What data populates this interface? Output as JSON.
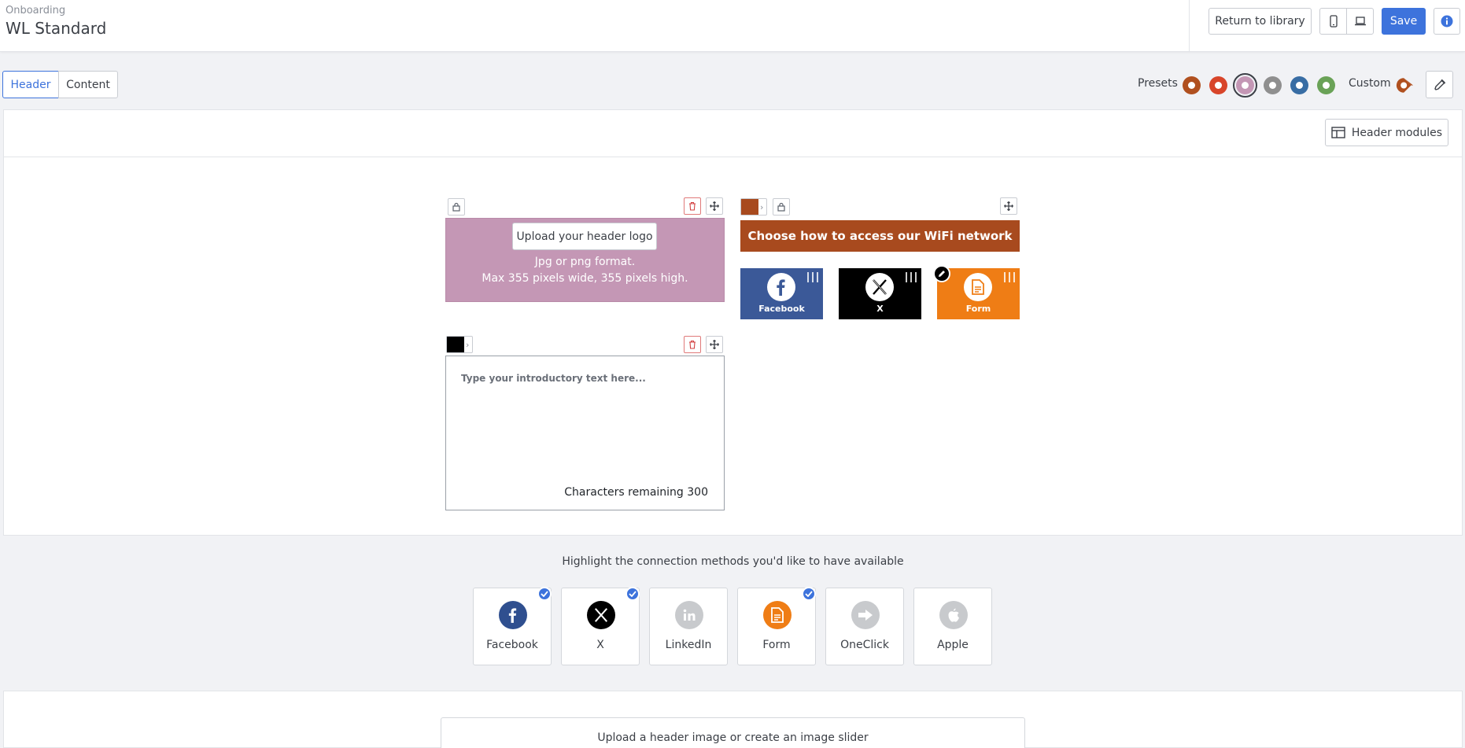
{
  "header": {
    "breadcrumb": "Onboarding",
    "title": "WL Standard",
    "return_label": "Return to library",
    "save_label": "Save",
    "mobile_icon": "mobile-icon",
    "desktop_icon": "laptop-icon",
    "info_icon": "info-icon"
  },
  "tabs": [
    {
      "label": "Header",
      "active": true
    },
    {
      "label": "Content",
      "active": false
    }
  ],
  "presets": {
    "label": "Presets",
    "swatches": [
      "#b0501f",
      "#d8452a",
      "#c497b5",
      "#8f8f8f",
      "#386da4",
      "#6aa257"
    ],
    "selected_index": 2,
    "custom_label": "Custom",
    "custom_color": "#b0501f",
    "eyedropper_icon": "eyedropper-icon"
  },
  "toolbar": {
    "header_modules_label": "Header modules"
  },
  "logo_module": {
    "upload_label": "Upload your header logo",
    "note_line1": "Jpg or png format.",
    "note_line2": "Max 355 pixels wide, 355 pixels high.",
    "bg_color": "#c497b5"
  },
  "access_module": {
    "title": "Choose how to access our WiFi network",
    "bg_color": "#a84a1e",
    "tiles": [
      {
        "name": "Facebook",
        "color": "#3b5998",
        "icon": "facebook-icon"
      },
      {
        "name": "X",
        "color": "#000000",
        "icon": "x-icon"
      },
      {
        "name": "Form",
        "color": "#ef7d15",
        "icon": "form-icon"
      }
    ]
  },
  "intro_module": {
    "placeholder": "Type your introductory text here...",
    "chars_remaining": "Characters remaining 300",
    "text_color": "#000000"
  },
  "methods": {
    "heading": "Highlight the connection methods you'd like to have available",
    "items": [
      {
        "label": "Facebook",
        "checked": true,
        "icon": "facebook-icon",
        "color": "#2f4f8f"
      },
      {
        "label": "X",
        "checked": true,
        "icon": "x-icon",
        "color": "#000000"
      },
      {
        "label": "LinkedIn",
        "checked": false,
        "icon": "linkedin-icon",
        "color": "#c8cacd"
      },
      {
        "label": "Form",
        "checked": true,
        "icon": "form-icon",
        "color": "#ef7d15"
      },
      {
        "label": "OneClick",
        "checked": false,
        "icon": "arrow-right-icon",
        "color": "#c8cacd"
      },
      {
        "label": "Apple",
        "checked": false,
        "icon": "apple-icon",
        "color": "#c8cacd"
      }
    ]
  },
  "image_upload": {
    "label": "Upload a header image or create an image slider"
  }
}
